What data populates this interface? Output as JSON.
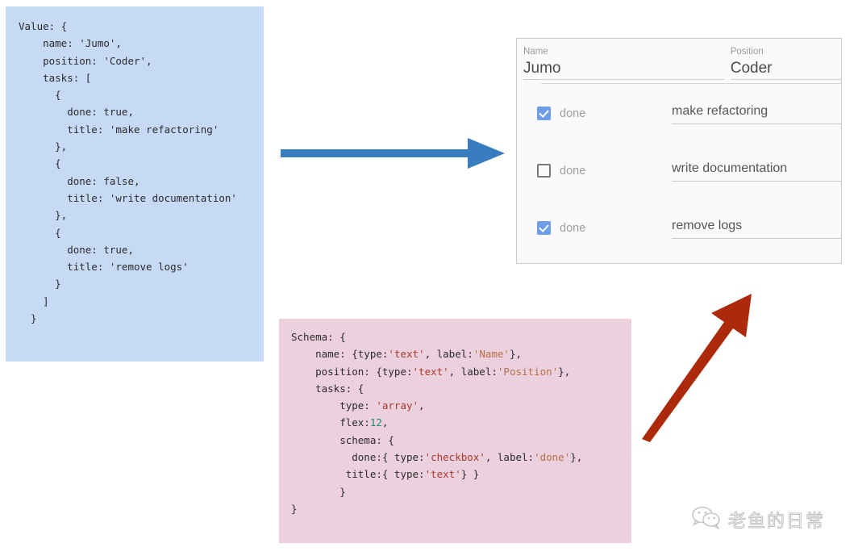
{
  "value_code": {
    "title": "Value code block",
    "lines": [
      "Value: {",
      "    name: 'Jumo',",
      "    position: 'Coder',",
      "    tasks: [",
      "      {",
      "        done: true,",
      "        title: 'make refactoring'",
      "      },",
      "      {",
      "        done: false,",
      "        title: 'write documentation'",
      "      },",
      "      {",
      "        done: true,",
      "        title: 'remove logs'",
      "      }",
      "    ]",
      "  }"
    ],
    "background_color": "#c6d9f5"
  },
  "schema_code": {
    "title": "Schema code block",
    "background_color": "#ecd0dd",
    "lines": [
      [
        {
          "t": "Schema: {"
        }
      ],
      [
        {
          "t": "    name: {type:"
        },
        {
          "t": "'text'",
          "c": "s-str"
        },
        {
          "t": ", label:"
        },
        {
          "t": "'Name'",
          "c": "s-lbl"
        },
        {
          "t": "},"
        }
      ],
      [
        {
          "t": "    position: {type:"
        },
        {
          "t": "'text'",
          "c": "s-str"
        },
        {
          "t": ", label:"
        },
        {
          "t": "'Position'",
          "c": "s-lbl"
        },
        {
          "t": "},"
        }
      ],
      [
        {
          "t": "    tasks: {"
        }
      ],
      [
        {
          "t": "        type: "
        },
        {
          "t": "'array'",
          "c": "s-str"
        },
        {
          "t": ","
        }
      ],
      [
        {
          "t": "        flex:"
        },
        {
          "t": "12",
          "c": "s-num"
        },
        {
          "t": ","
        }
      ],
      [
        {
          "t": "        schema: {"
        }
      ],
      [
        {
          "t": "          done:{ type:"
        },
        {
          "t": "'checkbox'",
          "c": "s-str"
        },
        {
          "t": ", label:"
        },
        {
          "t": "'done'",
          "c": "s-lbl"
        },
        {
          "t": "},"
        }
      ],
      [
        {
          "t": "         title:{ type:"
        },
        {
          "t": "'text'",
          "c": "s-str"
        },
        {
          "t": "} }"
        }
      ],
      [
        {
          "t": "        }"
        }
      ],
      [
        {
          "t": "}"
        }
      ]
    ]
  },
  "arrows": {
    "blue": {
      "name": "value-to-form-arrow",
      "color": "#3a7cc0",
      "direction": "right"
    },
    "red": {
      "name": "schema-to-form-arrow",
      "color": "#ac2a0b",
      "direction": "up-right"
    }
  },
  "form": {
    "header": {
      "name": {
        "label": "Name",
        "value": "Jumo"
      },
      "position": {
        "label": "Position",
        "value": "Coder"
      }
    },
    "checkbox_color": "#6f9ee8",
    "tasks": [
      {
        "done": true,
        "done_label": "done",
        "title": "make refactoring"
      },
      {
        "done": false,
        "done_label": "done",
        "title": "write documentation"
      },
      {
        "done": true,
        "done_label": "done",
        "title": "remove logs"
      }
    ]
  },
  "watermark": {
    "icon": "wechat-icon",
    "text": "老鱼的日常"
  }
}
